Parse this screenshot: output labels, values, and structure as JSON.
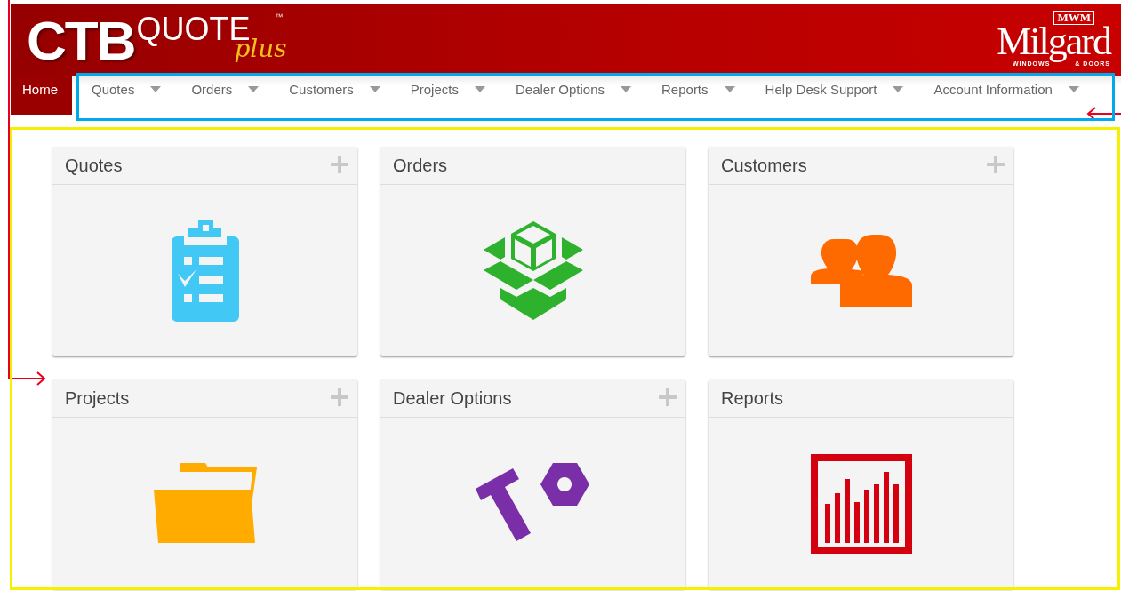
{
  "header": {
    "logo": {
      "main": "CTB",
      "word": "QUOTE",
      "tm": "™",
      "sub": "plus"
    },
    "brand": {
      "mark": "MWM",
      "name": "Milgard",
      "left": "WINDOWS",
      "right": "& DOORS"
    }
  },
  "nav": [
    {
      "label": "Home",
      "selected": true,
      "has_menu": false
    },
    {
      "label": "Quotes",
      "selected": false,
      "has_menu": true
    },
    {
      "label": "Orders",
      "selected": false,
      "has_menu": true
    },
    {
      "label": "Customers",
      "selected": false,
      "has_menu": true
    },
    {
      "label": "Projects",
      "selected": false,
      "has_menu": true
    },
    {
      "label": "Dealer Options",
      "selected": false,
      "has_menu": true
    },
    {
      "label": "Reports",
      "selected": false,
      "has_menu": true
    },
    {
      "label": "Help Desk Support",
      "selected": false,
      "has_menu": true
    },
    {
      "label": "Account Information",
      "selected": false,
      "has_menu": true
    }
  ],
  "tiles": [
    {
      "title": "Quotes",
      "kind": "clipboard",
      "can_add": true
    },
    {
      "title": "Orders",
      "kind": "box",
      "can_add": false
    },
    {
      "title": "Customers",
      "kind": "people",
      "can_add": true
    },
    {
      "title": "Projects",
      "kind": "folder",
      "can_add": true
    },
    {
      "title": "Dealer Options",
      "kind": "tools",
      "can_add": true
    },
    {
      "title": "Reports",
      "kind": "chart",
      "can_add": false
    }
  ]
}
